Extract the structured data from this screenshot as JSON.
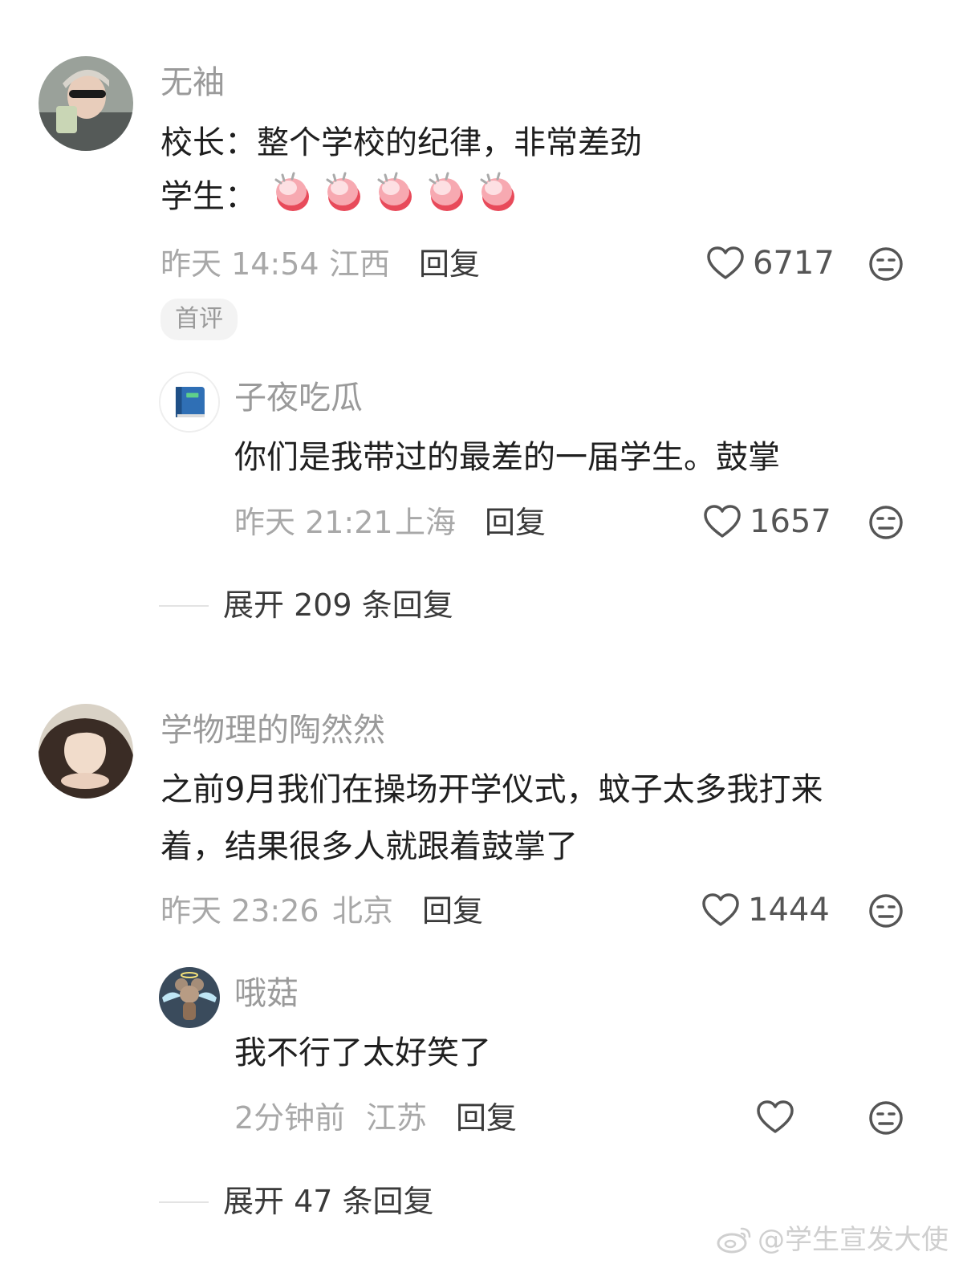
{
  "comments": [
    {
      "username": "无袖",
      "text_lines": [
        "校长：整个学校的纪律，非常差劲",
        "学生："
      ],
      "emoji": "clap-emoji",
      "emoji_count": 5,
      "time": "昨天 14:54",
      "location": "江西",
      "reply_label": "回复",
      "likes": "6717",
      "badge": "首评",
      "reply": {
        "username": "子夜吃瓜",
        "text": "你们是我带过的最差的一届学生。鼓掌",
        "time": "昨天 21:21",
        "location": "上海",
        "reply_label": "回复",
        "likes": "1657"
      },
      "expand_label": "展开 209 条回复"
    },
    {
      "username": "学物理的陶然然",
      "text_lines": [
        "之前9月我们在操场开学仪式，蚊子太多我打来",
        "着，结果很多人就跟着鼓掌了"
      ],
      "time": "昨天 23:26",
      "location": "北京",
      "reply_label": "回复",
      "likes": "1444",
      "reply": {
        "username": "哦菇",
        "text": "我不行了太好笑了",
        "time": "2分钟前",
        "location": "江苏",
        "reply_label": "回复",
        "likes": ""
      },
      "expand_label": "展开 47 条回复"
    }
  ],
  "watermark": "@学生宣发大使",
  "colors": {
    "username": "#9a9a9a",
    "meta": "#a8a8a8",
    "text": "#1f1f1f",
    "clap_pink": "#f48a96",
    "clap_red": "#e84a5a"
  }
}
